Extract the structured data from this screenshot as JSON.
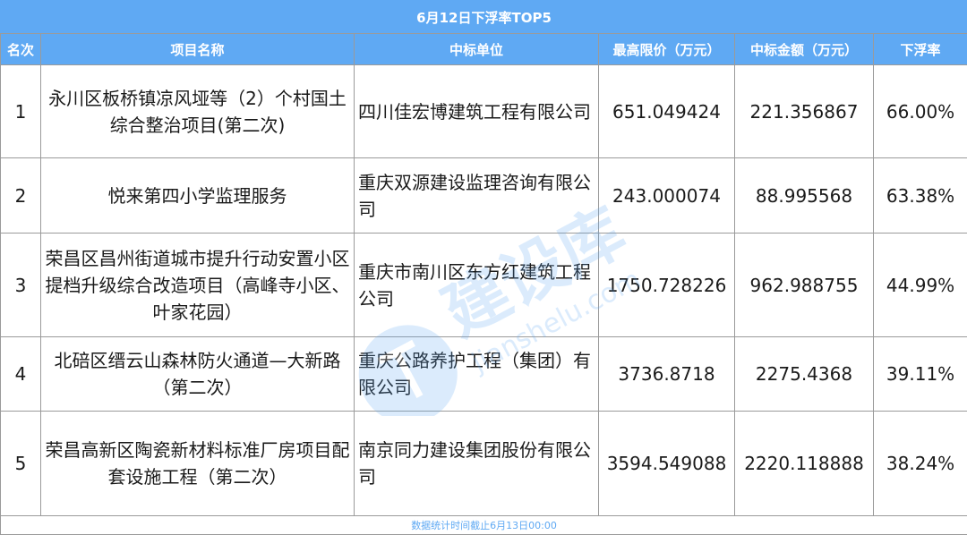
{
  "title": "6月12日下浮率TOP5",
  "columns": [
    "名次",
    "项目名称",
    "中标单位",
    "最高限价（万元）",
    "中标金额（万元）",
    "下浮率"
  ],
  "rows": [
    {
      "rank": "1",
      "project": "永川区板桥镇凉风垭等（2）个村国土综合整治项目(第二次)",
      "winner": "四川佳宏博建筑工程有限公司",
      "max_price": "651.049424",
      "bid_amount": "221.356867",
      "rate": "66.00%"
    },
    {
      "rank": "2",
      "project": "悦来第四小学监理服务",
      "winner": "重庆双源建设监理咨询有限公司",
      "max_price": "243.000074",
      "bid_amount": "88.995568",
      "rate": "63.38%"
    },
    {
      "rank": "3",
      "project": "荣昌区昌州街道城市提升行动安置小区提档升级综合改造项目（高峰寺小区、叶家花园）",
      "winner": "重庆市南川区东方红建筑工程公司",
      "max_price": "1750.728226",
      "bid_amount": "962.988755",
      "rate": "44.99%"
    },
    {
      "rank": "4",
      "project": "北碚区缙云山森林防火通道—大新路（第二次）",
      "winner": "重庆公路养护工程（集团）有限公司",
      "max_price": "3736.8718",
      "bid_amount": "2275.4368",
      "rate": "39.11%"
    },
    {
      "rank": "5",
      "project": "荣昌高新区陶瓷新材料标准厂房项目配套设施工程（第二次）",
      "winner": "南京同力建设集团股份有限公司",
      "max_price": "3594.549088",
      "bid_amount": "2220.118888",
      "rate": "38.24%"
    }
  ],
  "footer": "数据统计时间截止6月13日00:00",
  "watermark": {
    "brand": "建设库",
    "domain": "jianshelu.com"
  },
  "colors": {
    "header_bg": "#5fa9f3",
    "header_text": "#ffffff",
    "footer_text": "#5fa9f3",
    "border": "#9a9a9a"
  }
}
